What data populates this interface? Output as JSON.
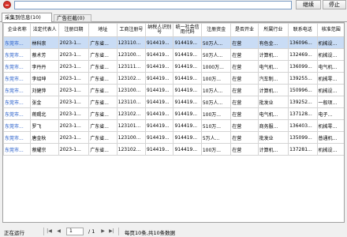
{
  "toolbar": {
    "continue_label": "继续",
    "stop_label": "停止"
  },
  "tabs": [
    {
      "label": "采集到信息(10)"
    },
    {
      "label": "广告拦截(0)"
    }
  ],
  "table": {
    "headers": [
      "企业名称",
      "法定代表人",
      "注册日期",
      "地址",
      "工商注册号",
      "纳税人识别号",
      "统一社会信用代码",
      "注册资金",
      "是否开业",
      "所属行业",
      "联系电话",
      "核准范围"
    ],
    "rows": [
      [
        "东莞市...",
        "林科崇",
        "2023-1...",
        "广东省...",
        "123110...",
        "914419...",
        "914419...",
        "50万人...",
        "在营",
        "有色金...",
        "136096...",
        "机械设..."
      ],
      [
        "东莞市...",
        "蔡术芳",
        "2023-1...",
        "广东省...",
        "123100...",
        "914419...",
        "914419...",
        "50万人...",
        "在营",
        "计算机...",
        "132469...",
        "机械设..."
      ],
      [
        "东莞市...",
        "李丹丹",
        "2023-1...",
        "广东省...",
        "123111...",
        "914419...",
        "914419...",
        "1000万...",
        "在营",
        "电气机...",
        "136099...",
        "电气机..."
      ],
      [
        "东莞市...",
        "李绍坤",
        "2023-1...",
        "广东省...",
        "123102...",
        "914419...",
        "914419...",
        "100万...",
        "在营",
        "汽车制...",
        "139255...",
        "机械零..."
      ],
      [
        "东莞市...",
        "刘健萍",
        "2023-1...",
        "广东省...",
        "123100...",
        "914419...",
        "914419...",
        "10万人...",
        "在营",
        "计算机...",
        "150996...",
        "机械设..."
      ],
      [
        "东莞市...",
        "张金",
        "2023-1...",
        "广东省...",
        "123110...",
        "914419...",
        "914419...",
        "50万人...",
        "在营",
        "批发业",
        "139252...",
        "一般项..."
      ],
      [
        "东莞市...",
        "蒋赐北",
        "2023-1...",
        "广东省...",
        "123102...",
        "914419...",
        "914419...",
        "100万...",
        "在营",
        "电气机...",
        "137128...",
        "电子..."
      ],
      [
        "东莞市...",
        "罗飞",
        "2023-1...",
        "广东省...",
        "123101...",
        "914419...",
        "914419...",
        "510万...",
        "在营",
        "商务服...",
        "136403...",
        "机械零..."
      ],
      [
        "东莞市...",
        "唐金秋",
        "2023-1...",
        "广东省...",
        "123100...",
        "914419...",
        "914419...",
        "5万人...",
        "在营",
        "批发业",
        "135099...",
        "普通机..."
      ],
      [
        "东莞市...",
        "蔡耀宗",
        "2023-1...",
        "广东省...",
        "123102...",
        "914419...",
        "914419...",
        "100万...",
        "在营",
        "计算机...",
        "137281...",
        "机械设..."
      ]
    ]
  },
  "status": {
    "text": "正在运行",
    "page_input": "1",
    "page_total": "/ 1",
    "summary": "每页10条,共10条数据"
  }
}
